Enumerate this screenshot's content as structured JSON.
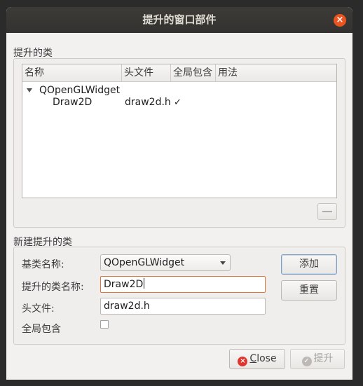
{
  "window": {
    "title": "提升的窗口部件",
    "close_icon": "close-icon"
  },
  "promoted_group": {
    "label": "提升的类",
    "columns": [
      "名称",
      "头文件",
      "全局包含",
      "用法"
    ],
    "tree": {
      "parent": "QOpenGLWidget",
      "child": {
        "name": "Draw2D",
        "header": "draw2d.h",
        "global_include_check": "✓"
      }
    }
  },
  "new_group": {
    "label": "新建提升的类",
    "base_class_label": "基类名称:",
    "base_class_value": "QOpenGLWidget",
    "promoted_name_label": "提升的类名称:",
    "promoted_name_value": "Draw2D",
    "header_label": "头文件:",
    "header_value": "draw2d.h",
    "global_include_label": "全局包含"
  },
  "buttons": {
    "add": "添加",
    "reset": "重置",
    "close_prefix": "",
    "close_underline": "C",
    "close_rest": "lose",
    "promote": "提升"
  }
}
